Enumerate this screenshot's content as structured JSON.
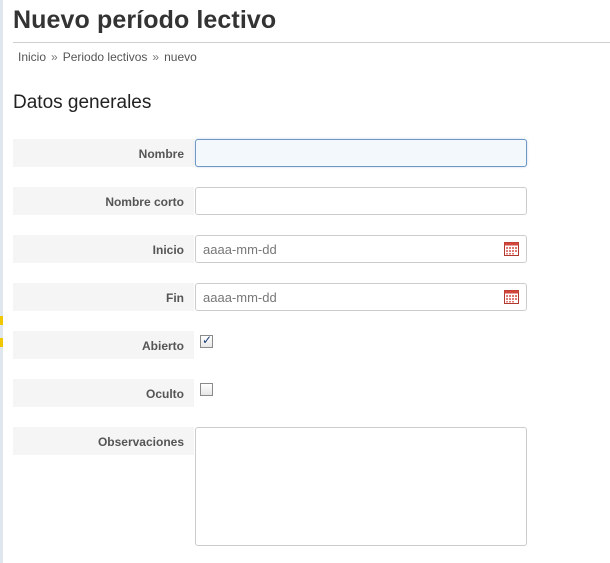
{
  "page": {
    "title": "Nuevo período lectivo"
  },
  "breadcrumb": {
    "separator": "»",
    "items": [
      "Inicio",
      "Periodo lectivos",
      "nuevo"
    ]
  },
  "section": {
    "title": "Datos generales"
  },
  "form": {
    "nombre": {
      "label": "Nombre",
      "value": ""
    },
    "nombre_corto": {
      "label": "Nombre corto",
      "value": ""
    },
    "inicio": {
      "label": "Inicio",
      "placeholder": "aaaa-mm-dd",
      "icon": "calendar-icon"
    },
    "fin": {
      "label": "Fin",
      "placeholder": "aaaa-mm-dd",
      "icon": "calendar-icon"
    },
    "abierto": {
      "label": "Abierto",
      "checked": true,
      "checkmark": "✓"
    },
    "oculto": {
      "label": "Oculto",
      "checked": false
    },
    "observaciones": {
      "label": "Observaciones",
      "value": ""
    }
  },
  "colors": {
    "focus_border": "#6f98c4",
    "label_bg": "#f5f5f5",
    "calendar_red": "#d2463c"
  }
}
